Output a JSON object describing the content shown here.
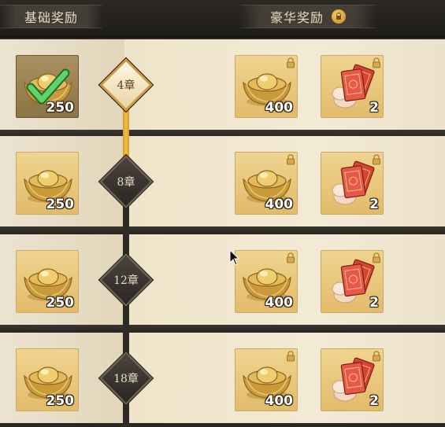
{
  "tabs": {
    "basic_label": "基础奖励",
    "premium_label": "豪华奖励",
    "premium_icon": "lock-icon"
  },
  "rows": [
    {
      "chapter": "4章",
      "reached": true,
      "basic": {
        "icon": "gold-ingot-icon",
        "count": "250",
        "claimed": true,
        "claimed_icon": "checkmark-icon"
      },
      "premium": [
        {
          "icon": "gold-ingot-icon",
          "count": "400",
          "locked": true
        },
        {
          "icon": "red-envelope-icon",
          "count": "2",
          "locked": true
        }
      ]
    },
    {
      "chapter": "8章",
      "reached": false,
      "basic": {
        "icon": "gold-ingot-icon",
        "count": "250",
        "claimed": false
      },
      "premium": [
        {
          "icon": "gold-ingot-icon",
          "count": "400",
          "locked": true
        },
        {
          "icon": "red-envelope-icon",
          "count": "2",
          "locked": true
        }
      ]
    },
    {
      "chapter": "12章",
      "reached": false,
      "basic": {
        "icon": "gold-ingot-icon",
        "count": "250",
        "claimed": false
      },
      "premium": [
        {
          "icon": "gold-ingot-icon",
          "count": "400",
          "locked": true
        },
        {
          "icon": "red-envelope-icon",
          "count": "2",
          "locked": true
        }
      ]
    },
    {
      "chapter": "18章",
      "reached": false,
      "basic": {
        "icon": "gold-ingot-icon",
        "count": "250",
        "claimed": false
      },
      "premium": [
        {
          "icon": "gold-ingot-icon",
          "count": "400",
          "locked": true
        },
        {
          "icon": "red-envelope-icon",
          "count": "2",
          "locked": true
        }
      ]
    }
  ],
  "colors": {
    "gold": "#e2bb6c",
    "progress": "#f0c24a",
    "dark": "#2a2622"
  }
}
